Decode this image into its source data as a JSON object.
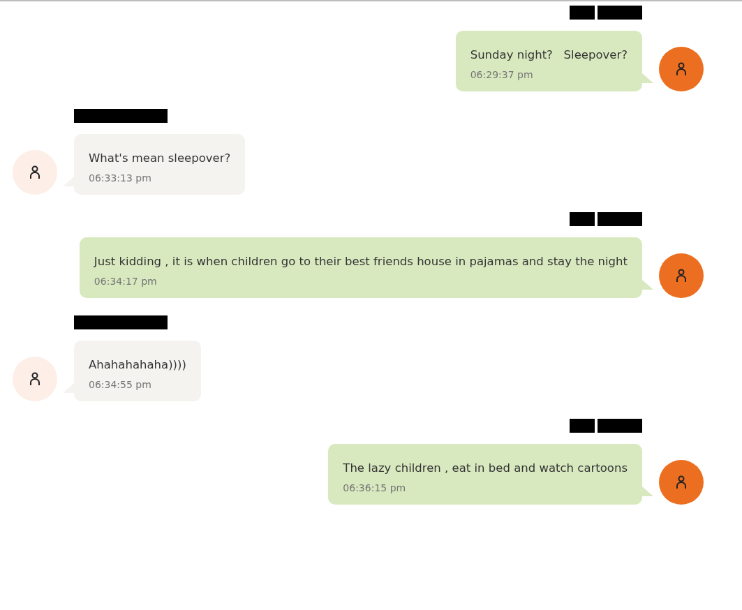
{
  "messages": [
    {
      "kind": "outgoing",
      "text": "Sunday night?   Sleepover?",
      "time": "06:29:37 pm"
    },
    {
      "kind": "incoming",
      "text": "What's mean sleepover?",
      "time": "06:33:13 pm"
    },
    {
      "kind": "outgoing",
      "text": "Just kidding , it is when children go to their best friends house in pajamas and stay the night",
      "time": "06:34:17 pm"
    },
    {
      "kind": "incoming",
      "text": "Ahahahahaha))))",
      "time": "06:34:55 pm"
    },
    {
      "kind": "outgoing",
      "text": "The lazy children , eat in bed and watch cartoons",
      "time": "06:36:15 pm"
    }
  ]
}
